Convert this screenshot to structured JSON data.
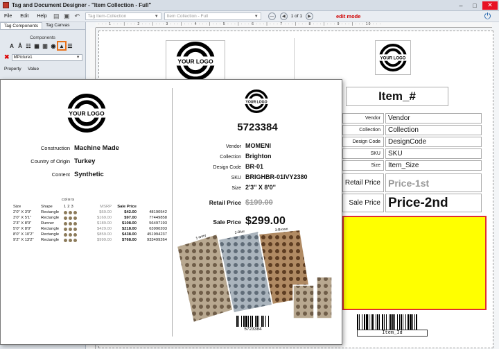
{
  "window": {
    "title": "Tag and Document Designer - \"Item Collection - Full\""
  },
  "menu": {
    "file": "File",
    "edit": "Edit",
    "help": "Help"
  },
  "toolbar": {
    "template_select": "Tag Item-Collection",
    "document_select": "Item Collection - Full",
    "page_indicator": "1 of 1",
    "mode": "edit mode"
  },
  "leftpanel": {
    "tabs": [
      "Tag Components",
      "Tag Canvas"
    ],
    "components_label": "Components",
    "component_icons": [
      "text-icon",
      "font-icon",
      "barcode-icon",
      "shape-icon",
      "columns-icon",
      "picture-icon",
      "image-icon",
      "list-icon"
    ],
    "selected_object": "MPicture1",
    "prop_header": "Property",
    "value_header": "Value"
  },
  "designer": {
    "item_num": "Item_#",
    "logo_text": "YOUR LOGO",
    "fields": [
      {
        "label": "Vendor",
        "value": "Vendor"
      },
      {
        "label": "Collection",
        "value": "Collection"
      },
      {
        "label": "Design Code",
        "value": "DesignCode"
      },
      {
        "label": "SKU",
        "value": "SKU"
      },
      {
        "label": "Size",
        "value": "Item_Size"
      }
    ],
    "retail_label": "Retail Price",
    "retail_value": "Price-1st",
    "sale_label": "Sale Price",
    "sale_value": "Price-2nd",
    "barcode_label": "Item_Id"
  },
  "preview": {
    "logo_text": "YOUR LOGO",
    "left_attrs": [
      {
        "k": "Construction",
        "v": "Machine Made"
      },
      {
        "k": "Country of Origin",
        "v": "Turkey"
      },
      {
        "k": "Content",
        "v": "Synthetic"
      }
    ],
    "colors_label": "colors",
    "table_headers": {
      "size": "Size",
      "shape": "Shape",
      "c1": "1",
      "c2": "2",
      "c3": "3",
      "msrp": "MSRP",
      "sale": "Sale Price"
    },
    "table_rows": [
      {
        "size": "2'0\" X 3'0\"",
        "shape": "Rectangle",
        "msrp": "$69.00",
        "sale": "$42.00",
        "sku": "48190542"
      },
      {
        "size": "3'0\" X 5'1\"",
        "shape": "Rectangle",
        "msrp": "$169.00",
        "sale": "$97.00",
        "sku": "77449858"
      },
      {
        "size": "2'3\" X 8'0\"",
        "shape": "Runner",
        "msrp": "$189.00",
        "sale": "$108.00",
        "sku": "56497193"
      },
      {
        "size": "5'0\" X 8'0\"",
        "shape": "Rectangle",
        "msrp": "$429.00",
        "sale": "$218.00",
        "sku": "63990203"
      },
      {
        "size": "8'0\" X 10'2\"",
        "shape": "Rectangle",
        "msrp": "$859.00",
        "sale": "$438.00",
        "sku": "451994237"
      },
      {
        "size": "9'2\" X 13'2\"",
        "shape": "Rectangle",
        "msrp": "$999.00",
        "sale": "$768.00",
        "sku": "933499264"
      }
    ],
    "item_number": "5723384",
    "right_attrs": [
      {
        "k": "Vendor",
        "v": "MOMENI"
      },
      {
        "k": "Collection",
        "v": "Brighton"
      },
      {
        "k": "Design Code",
        "v": "BR-01"
      },
      {
        "k": "SKU",
        "v": "BRIGHBR-01IVY2380"
      },
      {
        "k": "Size",
        "v": "2'3'' X 8'0''"
      }
    ],
    "retail_label": "Retail Price",
    "retail_value": "$199.00",
    "sale_label": "Sale Price",
    "sale_value": "$299.00",
    "rug_labels": [
      "1-Ivory",
      "2-Blue",
      "3-Brown"
    ],
    "barcode_number": "5723384"
  }
}
